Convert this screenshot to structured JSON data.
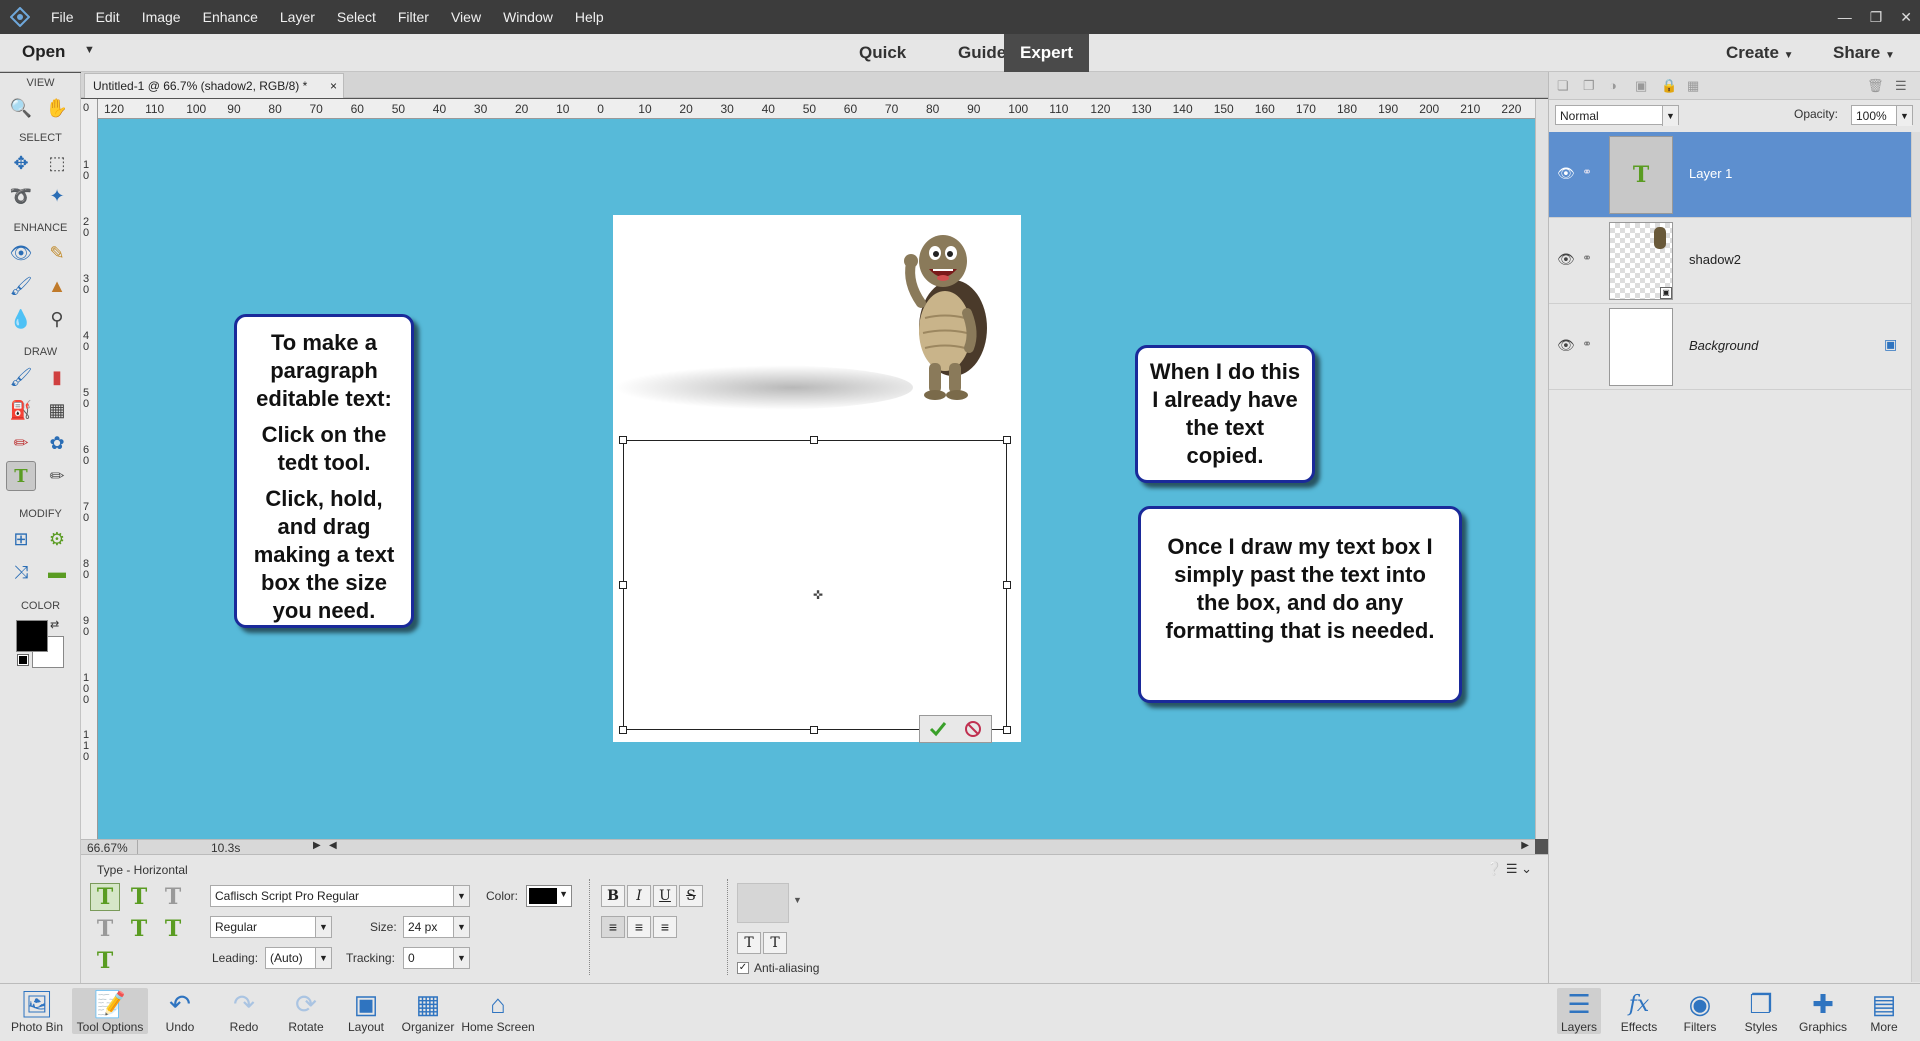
{
  "menubar": {
    "items": [
      "File",
      "Edit",
      "Image",
      "Enhance",
      "Layer",
      "Select",
      "Filter",
      "View",
      "Window",
      "Help"
    ]
  },
  "modebar": {
    "open": "Open",
    "modes": [
      "Quick",
      "Guided",
      "Expert"
    ],
    "active_mode": "Expert",
    "create": "Create",
    "share": "Share"
  },
  "toolbox": {
    "sections": [
      "VIEW",
      "SELECT",
      "ENHANCE",
      "DRAW",
      "MODIFY",
      "COLOR"
    ],
    "foreground_color": "#000000",
    "background_color": "#ffffff"
  },
  "document": {
    "tab_title": "Untitled-1 @ 66.7% (shadow2, RGB/8) *",
    "close": "×",
    "ruler_top": [
      "120",
      "110",
      "100",
      "90",
      "80",
      "70",
      "60",
      "50",
      "40",
      "30",
      "20",
      "10",
      "0",
      "10",
      "20",
      "30",
      "40",
      "50",
      "60",
      "70",
      "80",
      "90",
      "100",
      "110",
      "120",
      "130",
      "140",
      "150",
      "160",
      "170",
      "180",
      "190",
      "200",
      "210",
      "220"
    ],
    "ruler_left": [
      "0",
      "10",
      "20",
      "30",
      "40",
      "50",
      "60",
      "70",
      "80",
      "90",
      "100",
      "110"
    ],
    "canvas_color": "#57bad9"
  },
  "callouts": {
    "left": [
      "To make a paragraph editable text:",
      "Click on the tedt tool.",
      "Click, hold, and drag making a text box the size you need."
    ],
    "right_top": "When I do this I already have the text copied.",
    "right_bottom": "Once I draw my text box I simply past the text into the box, and do any formatting that is needed."
  },
  "status": {
    "zoom": "66.67%",
    "time": "10.3s"
  },
  "tool_options": {
    "title": "Type - Horizontal",
    "font_family": "Caflisch Script Pro Regular",
    "font_style": "Regular",
    "size_label": "Size:",
    "size": "24 px",
    "leading_label": "Leading:",
    "leading": "(Auto)",
    "tracking_label": "Tracking:",
    "tracking": "0",
    "color_label": "Color:",
    "text_color": "#000000",
    "bold": "B",
    "italic": "I",
    "underline": "U",
    "strike": "S",
    "anti_aliasing": "Anti-aliasing"
  },
  "layers_panel": {
    "blend_mode": "Normal",
    "opacity_label": "Opacity:",
    "opacity": "100%",
    "layers": [
      {
        "name": "Layer 1",
        "selected": true
      },
      {
        "name": "shadow2",
        "selected": false
      },
      {
        "name": "Background",
        "selected": false
      }
    ]
  },
  "taskbar": {
    "left": [
      "Photo Bin",
      "Tool Options",
      "Undo",
      "Redo",
      "Rotate",
      "Layout",
      "Organizer",
      "Home Screen"
    ],
    "right": [
      "Layers",
      "Effects",
      "Filters",
      "Styles",
      "Graphics",
      "More"
    ]
  }
}
